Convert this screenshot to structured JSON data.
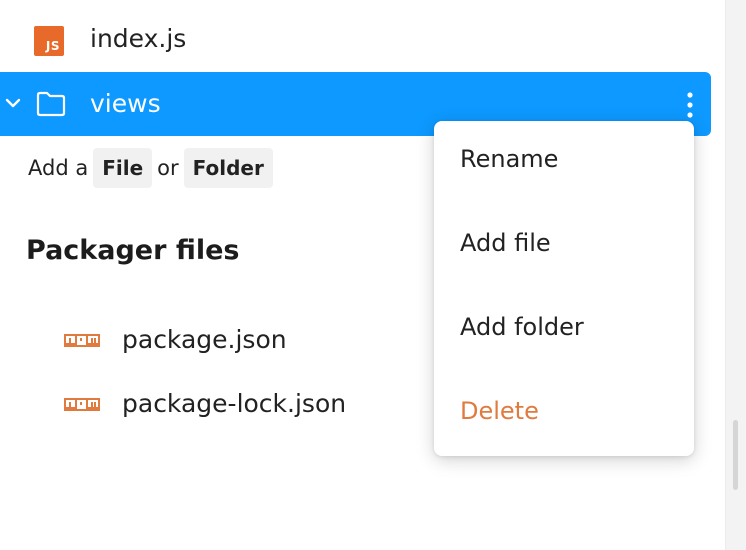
{
  "tree": {
    "file_row": {
      "label": "index.js",
      "icon": "js-file-icon",
      "icon_text": "JS",
      "icon_color": "#e86a2a"
    },
    "folder_row": {
      "label": "views",
      "icon": "folder-icon",
      "selected_color": "#0d99ff"
    }
  },
  "add": {
    "prefix": "Add a",
    "file_chip": "File",
    "or": "or",
    "folder_chip": "Folder"
  },
  "packager": {
    "title": "Packager files",
    "files": [
      {
        "label": "package.json",
        "icon": "npm-icon"
      },
      {
        "label": "package-lock.json",
        "icon": "npm-icon"
      }
    ],
    "npm_color": "#e07a3e"
  },
  "context_menu": {
    "items": [
      {
        "label": "Rename"
      },
      {
        "label": "Add file"
      },
      {
        "label": "Add folder"
      },
      {
        "label": "Delete",
        "color": "#e07a3e"
      }
    ]
  }
}
